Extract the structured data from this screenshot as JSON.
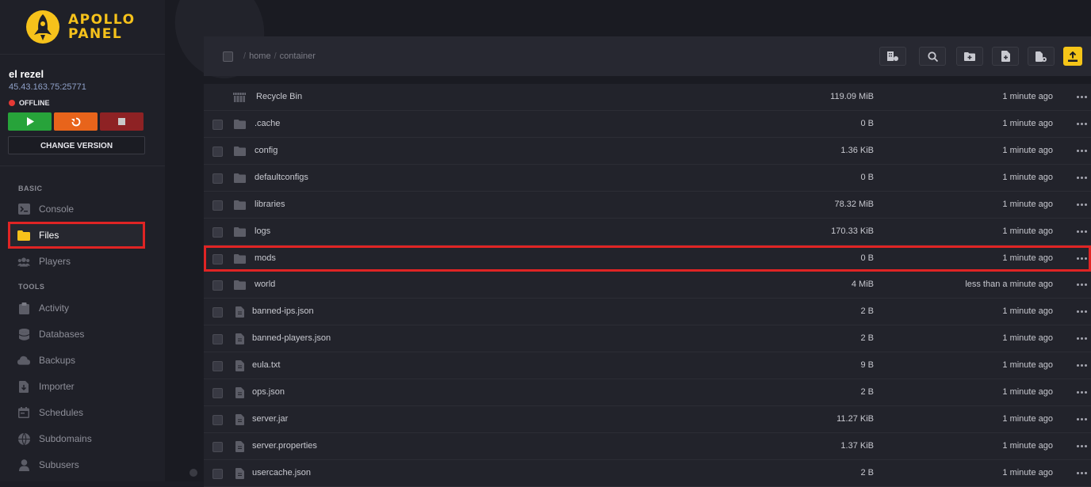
{
  "brand": {
    "line1": "APOLLO",
    "line2": "PANEL"
  },
  "server": {
    "name": "el rezel",
    "address": "45.43.163.75:25771",
    "status": "OFFLINE",
    "change_version_label": "CHANGE VERSION"
  },
  "colors": {
    "accent": "#f6c21b",
    "start": "#27a33a",
    "restart": "#e8641b",
    "stop": "#8e2224",
    "offline": "#e53935",
    "highlight": "#e02424"
  },
  "nav": {
    "basic_label": "BASIC",
    "tools_label": "TOOLS",
    "items": [
      {
        "label": "Console",
        "icon": "terminal-icon"
      },
      {
        "label": "Files",
        "icon": "folder-icon",
        "active": true
      },
      {
        "label": "Players",
        "icon": "users-icon"
      },
      {
        "label": "Activity",
        "icon": "clipboard-icon"
      },
      {
        "label": "Databases",
        "icon": "database-icon"
      },
      {
        "label": "Backups",
        "icon": "cloud-icon"
      },
      {
        "label": "Importer",
        "icon": "file-import-icon"
      },
      {
        "label": "Schedules",
        "icon": "calendar-icon"
      },
      {
        "label": "Subdomains",
        "icon": "globe-icon"
      },
      {
        "label": "Subusers",
        "icon": "user-icon"
      }
    ]
  },
  "breadcrumb": {
    "sep": "/",
    "parts": [
      "home",
      "container"
    ]
  },
  "toolbar": [
    "building-icon",
    "search-icon",
    "new-folder-icon",
    "new-file-icon",
    "file-settings-icon",
    "upload-icon"
  ],
  "files": [
    {
      "name": "Recycle Bin",
      "size": "119.09 MiB",
      "modified": "1 minute ago",
      "type": "recycle"
    },
    {
      "name": ".cache",
      "size": "0 B",
      "modified": "1 minute ago",
      "type": "folder"
    },
    {
      "name": "config",
      "size": "1.36 KiB",
      "modified": "1 minute ago",
      "type": "folder"
    },
    {
      "name": "defaultconfigs",
      "size": "0 B",
      "modified": "1 minute ago",
      "type": "folder"
    },
    {
      "name": "libraries",
      "size": "78.32 MiB",
      "modified": "1 minute ago",
      "type": "folder"
    },
    {
      "name": "logs",
      "size": "170.33 KiB",
      "modified": "1 minute ago",
      "type": "folder"
    },
    {
      "name": "mods",
      "size": "0 B",
      "modified": "1 minute ago",
      "type": "folder",
      "highlighted": true
    },
    {
      "name": "world",
      "size": "4 MiB",
      "modified": "less than a minute ago",
      "type": "folder"
    },
    {
      "name": "banned-ips.json",
      "size": "2 B",
      "modified": "1 minute ago",
      "type": "file"
    },
    {
      "name": "banned-players.json",
      "size": "2 B",
      "modified": "1 minute ago",
      "type": "file"
    },
    {
      "name": "eula.txt",
      "size": "9 B",
      "modified": "1 minute ago",
      "type": "file"
    },
    {
      "name": "ops.json",
      "size": "2 B",
      "modified": "1 minute ago",
      "type": "file"
    },
    {
      "name": "server.jar",
      "size": "11.27 KiB",
      "modified": "1 minute ago",
      "type": "file"
    },
    {
      "name": "server.properties",
      "size": "1.37 KiB",
      "modified": "1 minute ago",
      "type": "file"
    },
    {
      "name": "usercache.json",
      "size": "2 B",
      "modified": "1 minute ago",
      "type": "file"
    }
  ]
}
